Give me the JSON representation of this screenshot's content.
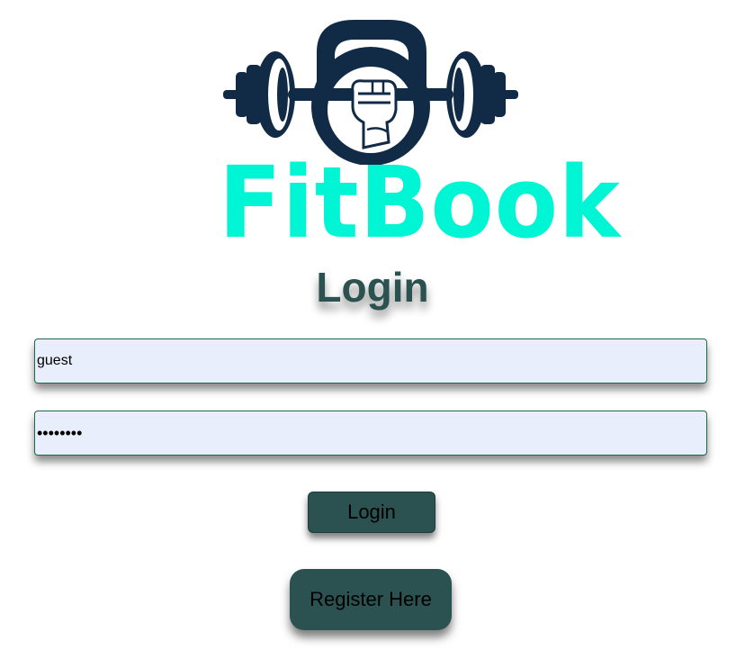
{
  "brand": {
    "name": "FitBook",
    "logo_icon": "kettlebell-barbell-fist-icon",
    "colors": {
      "brand_text": "#00f5d4",
      "logo_navy": "#112b47",
      "accent_dark": "#2b5150",
      "input_bg": "#e8eefc"
    }
  },
  "page": {
    "title": "Login"
  },
  "form": {
    "username_value": "guest",
    "password_value": "guestpwd",
    "login_label": "Login",
    "register_label": "Register Here"
  }
}
